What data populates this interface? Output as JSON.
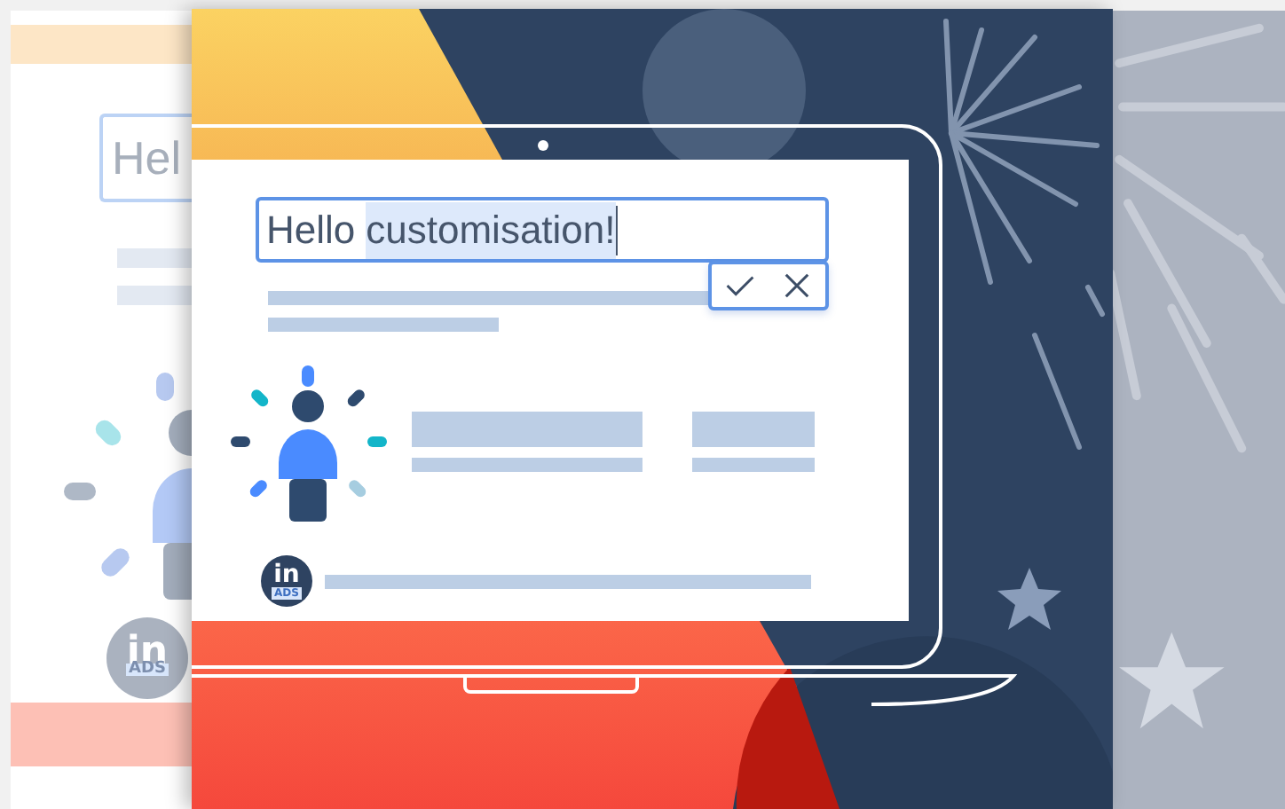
{
  "back_card": {
    "field_text": "Hel",
    "logo": {
      "mark": "in",
      "caption": "ADS"
    }
  },
  "laptop_screen": {
    "headline_field": {
      "text": "Hello",
      "selected_text": "customisation!"
    },
    "edit_actions": [
      {
        "kind": "confirm"
      },
      {
        "kind": "cancel"
      }
    ],
    "logo": {
      "mark": "in",
      "caption": "ADS"
    }
  }
}
